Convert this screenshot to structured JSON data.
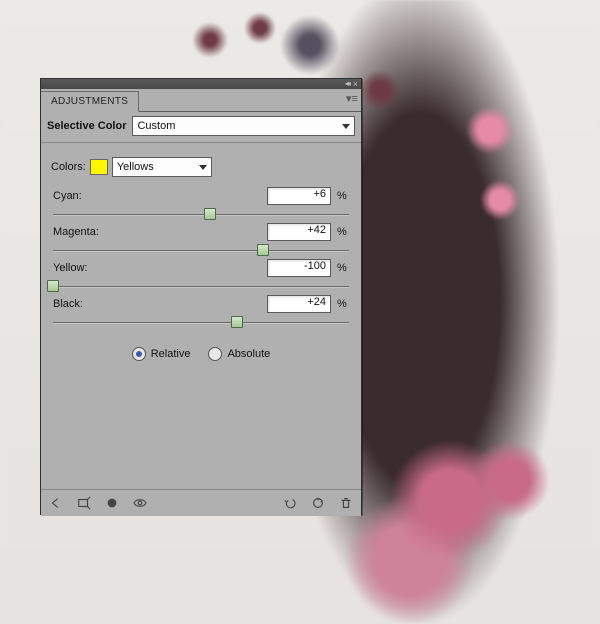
{
  "panel": {
    "tab_label": "ADJUSTMENTS",
    "adjustment_name": "Selective Color",
    "preset_dropdown": "Custom",
    "colors_label": "Colors:",
    "colors_dropdown": "Yellows",
    "swatch_color": "#fff700",
    "sliders": {
      "cyan": {
        "label": "Cyan:",
        "value": "+6",
        "pct": "%"
      },
      "magenta": {
        "label": "Magenta:",
        "value": "+42",
        "pct": "%"
      },
      "yellow": {
        "label": "Yellow:",
        "value": "-100",
        "pct": "%"
      },
      "black": {
        "label": "Black:",
        "value": "+24",
        "pct": "%"
      }
    },
    "method": {
      "relative": "Relative",
      "absolute": "Absolute",
      "selected": "relative"
    }
  }
}
